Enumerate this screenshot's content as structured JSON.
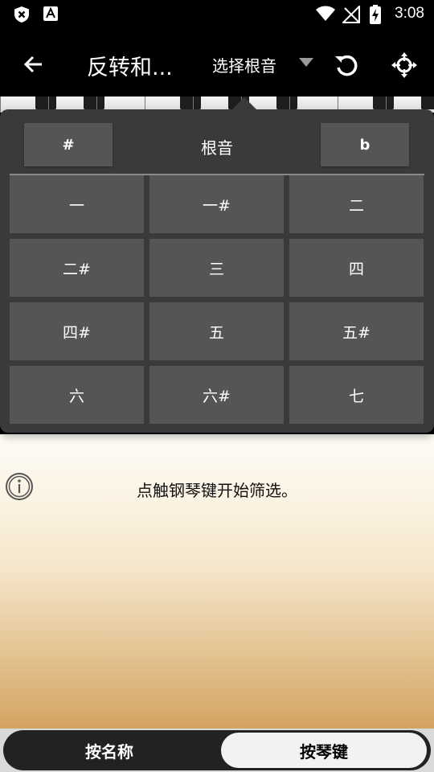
{
  "status_bar": {
    "time": "3:08",
    "left_icons": [
      "shield-x-icon",
      "a-badge-icon"
    ],
    "right_icons": [
      "wifi-icon",
      "no-signal-icon",
      "battery-charging-icon"
    ]
  },
  "app_bar": {
    "title": "反转和...",
    "root_select_label": "选择根音"
  },
  "popup": {
    "sharp_label": "#",
    "header_label": "根音",
    "flat_label": "b",
    "notes": [
      "一",
      "一#",
      "二",
      "二#",
      "三",
      "四",
      "四#",
      "五",
      "五#",
      "六",
      "六#",
      "七"
    ]
  },
  "main": {
    "hint": "点触钢琴键开始筛选。"
  },
  "bottom": {
    "by_name_label": "按名称",
    "by_key_label": "按琴键",
    "selected": "按琴键"
  },
  "colors": {
    "panel": "#3a3a3c",
    "cell": "#555557",
    "background_top": "#fffdf8",
    "background_bottom": "#d4a461"
  }
}
